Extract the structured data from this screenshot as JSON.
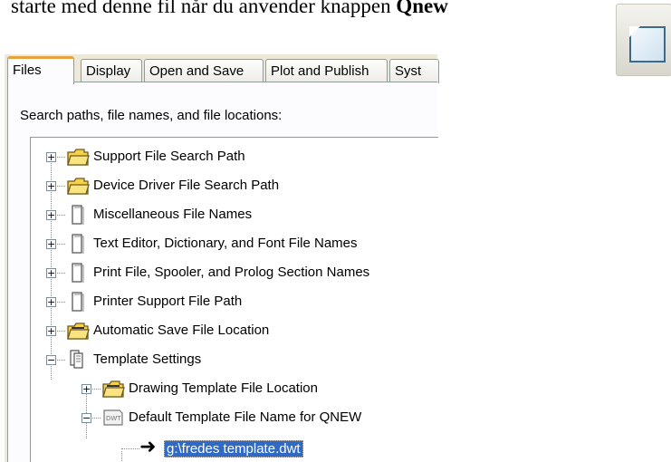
{
  "caption": {
    "text": "starte med denne fil når du anvender knappen ",
    "bold": "Qnew"
  },
  "qnew_button": {
    "icon": "new-document-icon"
  },
  "dialog": {
    "tabs": [
      {
        "label": "Files",
        "active": true
      },
      {
        "label": "Display",
        "active": false
      },
      {
        "label": "Open and Save",
        "active": false
      },
      {
        "label": "Plot and Publish",
        "active": false
      },
      {
        "label": "Syst",
        "active": false
      }
    ],
    "panel_label": "Search paths, file names, and file locations:",
    "tree": [
      {
        "label": "Support File Search Path",
        "expander": "+",
        "icon": "folder-icon"
      },
      {
        "label": "Device Driver File Search Path",
        "expander": "+",
        "icon": "folder-icon"
      },
      {
        "label": "Miscellaneous File Names",
        "expander": "+",
        "icon": "document-icon"
      },
      {
        "label": "Text Editor, Dictionary, and Font File Names",
        "expander": "+",
        "icon": "document-icon"
      },
      {
        "label": "Print File, Spooler, and Prolog Section Names",
        "expander": "+",
        "icon": "document-icon"
      },
      {
        "label": "Printer Support File Path",
        "expander": "+",
        "icon": "document-icon"
      },
      {
        "label": "Automatic Save File Location",
        "expander": "+",
        "icon": "folder-icon"
      },
      {
        "label": "Template Settings",
        "expander": "−",
        "icon": "template-settings-icon"
      },
      {
        "label": "Drawing Template File Location",
        "expander": "+",
        "icon": "folder-icon"
      },
      {
        "label": "Default Template File Name for QNEW",
        "expander": "−",
        "icon": "dwt-file-icon"
      },
      {
        "label": "g:\\fredes template.dwt",
        "expander": "",
        "icon": "arrow-right-icon",
        "selected": true
      }
    ],
    "colors": {
      "selection": "#316ac5",
      "active_tab_accent": "#e6a23c",
      "folder": "#f6d14a"
    }
  }
}
